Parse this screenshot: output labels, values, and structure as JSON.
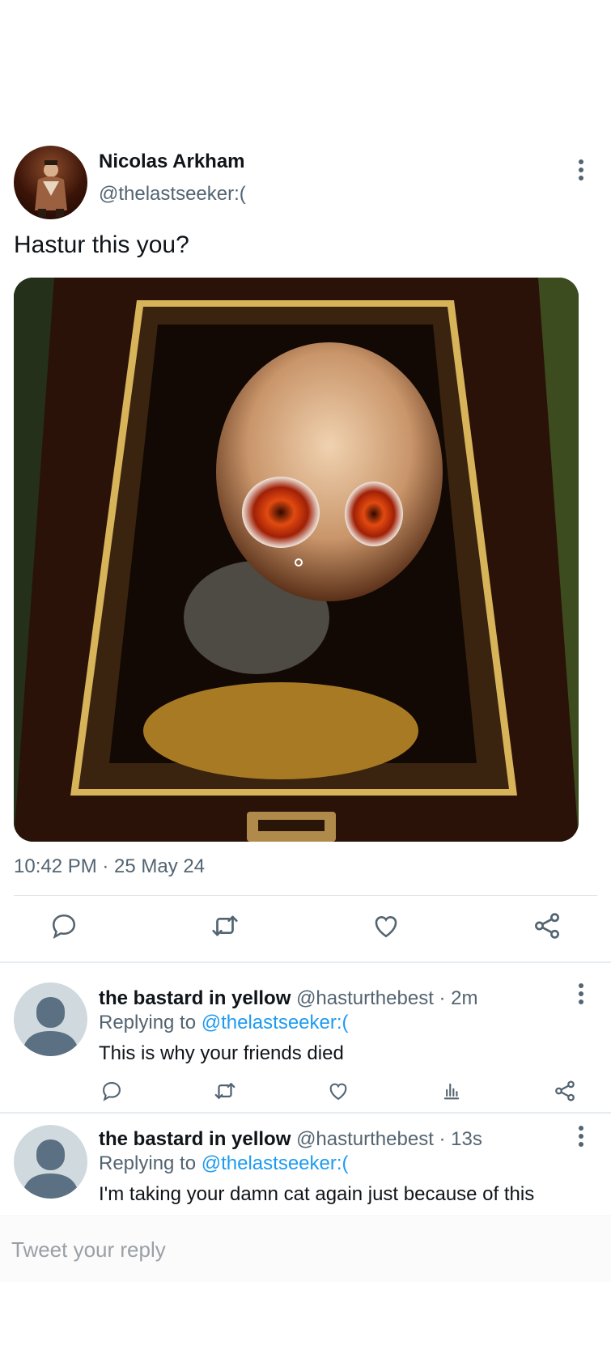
{
  "tweet": {
    "author_name": "Nicolas Arkham",
    "author_handle": "@thelastseeker:(",
    "text": "Hastur this you?",
    "timestamp": "10:42 PM · 25 May 24",
    "media_icon": "portrait-painting-image",
    "actions": [
      "reply-icon",
      "retweet-icon",
      "like-icon",
      "share-icon"
    ]
  },
  "replies": [
    {
      "name": "the bastard in yellow",
      "handle": "@hasturthebest · 2m",
      "replying_prefix": "Replying to ",
      "replying_to": "@thelastseeker:(",
      "text": "This is why your friends died",
      "actions": [
        "reply-icon",
        "retweet-icon",
        "like-icon",
        "stats-icon",
        "share-icon"
      ]
    },
    {
      "name": "the bastard in yellow",
      "handle": "@hasturthebest · 13s",
      "replying_prefix": "Replying to ",
      "replying_to": "@thelastseeker:(",
      "text": "I'm taking your damn cat again just because of this"
    }
  ],
  "compose": {
    "placeholder": "Tweet your reply"
  },
  "colors": {
    "text_primary": "#0f1419",
    "text_secondary": "#536471",
    "link": "#1d9bf0",
    "divider": "#e1e6ea"
  }
}
